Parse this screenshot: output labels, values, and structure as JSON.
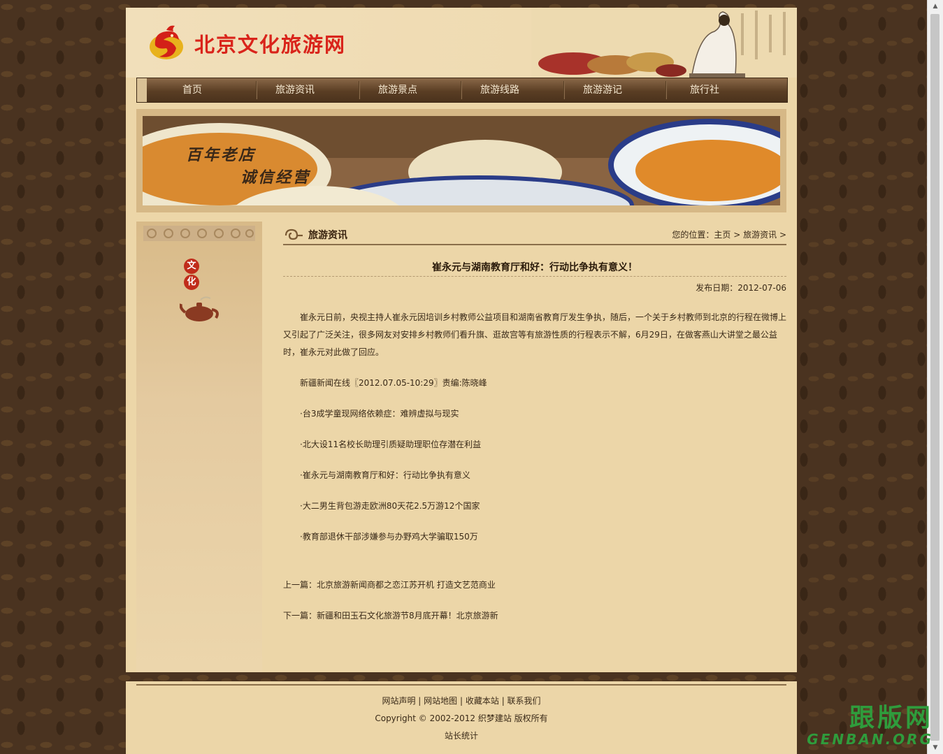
{
  "header": {
    "site_title": "北京文化旅游网"
  },
  "nav": [
    {
      "label": "首页"
    },
    {
      "label": "旅游资讯"
    },
    {
      "label": "旅游景点"
    },
    {
      "label": "旅游线路"
    },
    {
      "label": "旅游游记"
    },
    {
      "label": "旅行社"
    }
  ],
  "banner": {
    "line1": "百年老店",
    "line2": "诚信经营"
  },
  "sidebar": {
    "char1": "文",
    "char2": "化"
  },
  "section": {
    "title": "旅游资讯",
    "breadcrumb_prefix": "您的位置：",
    "breadcrumb_home": "主页",
    "breadcrumb_current": "旅游资讯"
  },
  "article": {
    "title": "崔永元与湖南教育厅和好：行动比争执有意义！",
    "date_label": "发布日期：",
    "date": "2012-07-06",
    "paragraph": "崔永元日前，央视主持人崔永元因培训乡村教师公益项目和湖南省教育厅发生争执，随后，一个关于乡村教师到北京的行程在微博上又引起了广泛关注，很多网友对安排乡村教师们看升旗、逛故宫等有旅游性质的行程表示不解，6月29日，在做客燕山大讲堂之最公益时，崔永元对此做了回应。",
    "source": "新疆新闻在线〖2012.07.05-10:29〗责编:陈晓峰",
    "related": [
      "·台3成学童现网络依赖症：难辨虚拟与现实",
      "·北大设11名校长助理引质疑助理职位存潜在利益",
      "·崔永元与湖南教育厅和好：行动比争执有意义",
      "·大二男生背包游走欧洲80天花2.5万游12个国家",
      "·教育部退休干部涉嫌参与办野鸡大学骗取150万"
    ],
    "prev_label": "上一篇：",
    "prev_title": "北京旅游新闻商都之恋江苏开机 打造文艺范商业",
    "next_label": "下一篇：",
    "next_title": "新疆和田玉石文化旅游节8月底开幕！北京旅游新"
  },
  "footer": {
    "links": [
      "网站声明",
      "网站地图",
      "收藏本站",
      "联系我们"
    ],
    "copyright": "Copyright © 2002-2012 织梦建站  版权所有",
    "stats": "站长统计"
  },
  "watermark": {
    "cn": "跟版网",
    "en": "GENBAN.ORG"
  },
  "colors": {
    "title_red": "#d9241b",
    "nav_bg": "#5a3e24",
    "page_bg": "#ecd6a8",
    "watermark_green": "#2f9c3c"
  }
}
